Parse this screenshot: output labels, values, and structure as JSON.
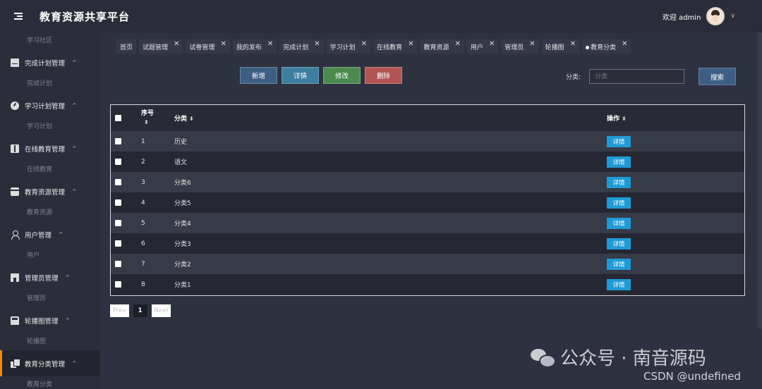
{
  "header": {
    "app_title": "教育资源共享平台",
    "welcome": "欢迎 admin"
  },
  "sidebar": {
    "top_sub": "学习社区",
    "groups": [
      {
        "label": "完成计划管理",
        "sub": "完成计划",
        "icon": "archive-icon"
      },
      {
        "label": "学习计划管理",
        "sub": "学习计划",
        "icon": "compass-icon"
      },
      {
        "label": "在线教育管理",
        "sub": "在线教育",
        "icon": "briefcase-icon"
      },
      {
        "label": "教育资源管理",
        "sub": "教育资源",
        "icon": "card-icon"
      },
      {
        "label": "用户管理",
        "sub": "用户",
        "icon": "user-icon"
      },
      {
        "label": "管理员管理",
        "sub": "管理员",
        "icon": "shop-icon"
      },
      {
        "label": "轮播图管理",
        "sub": "轮播图",
        "icon": "car-icon"
      },
      {
        "label": "教育分类管理",
        "sub": "教育分类",
        "icon": "copy-icon"
      }
    ],
    "caret": "^"
  },
  "tabs": [
    {
      "label": "首页",
      "closable": false
    },
    {
      "label": "试题管理",
      "closable": true
    },
    {
      "label": "试卷管理",
      "closable": true
    },
    {
      "label": "我的发布",
      "closable": true
    },
    {
      "label": "完成计划",
      "closable": true
    },
    {
      "label": "学习计划",
      "closable": true
    },
    {
      "label": "在线教育",
      "closable": true
    },
    {
      "label": "教育资源",
      "closable": true
    },
    {
      "label": "用户",
      "closable": true
    },
    {
      "label": "管理员",
      "closable": true
    },
    {
      "label": "轮播图",
      "closable": true
    },
    {
      "label": "教育分类",
      "closable": true,
      "active": true
    }
  ],
  "tab_close": "✕",
  "actions": {
    "add": "新增",
    "detail": "详情",
    "edit": "修改",
    "delete": "删除"
  },
  "search": {
    "label": "分类:",
    "placeholder": "分类",
    "button": "搜索"
  },
  "table": {
    "headers": {
      "no": "序号",
      "category": "分类",
      "operation": "操作"
    },
    "sort_icon": "⬍",
    "rows": [
      {
        "no": "1",
        "category": "历史",
        "action": "详情"
      },
      {
        "no": "2",
        "category": "语文",
        "action": "详情"
      },
      {
        "no": "3",
        "category": "分类6",
        "action": "详情"
      },
      {
        "no": "4",
        "category": "分类5",
        "action": "详情"
      },
      {
        "no": "5",
        "category": "分类4",
        "action": "详情"
      },
      {
        "no": "6",
        "category": "分类3",
        "action": "详情"
      },
      {
        "no": "7",
        "category": "分类2",
        "action": "详情"
      },
      {
        "no": "8",
        "category": "分类1",
        "action": "详情"
      }
    ]
  },
  "pagination": {
    "prev": "Prev",
    "current": "1",
    "next": "Next"
  },
  "watermark": {
    "wechat": "公众号 · 南音源码",
    "csdn": "CSDN @undefined"
  }
}
